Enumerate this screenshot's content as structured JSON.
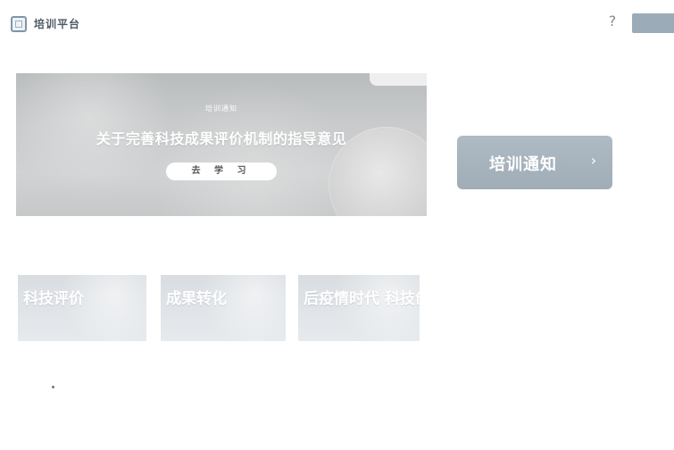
{
  "header": {
    "brand": "培训平台",
    "help_icon_glyph": "?",
    "right_button_label": ""
  },
  "banner": {
    "kicker": "培训通知",
    "title": "关于完善科技成果评价机制的指导意见",
    "button_label": "去 学 习"
  },
  "notice": {
    "label": "培训通知",
    "arrow_icon": "chevron-right-icon",
    "arrow_glyph": "›"
  },
  "thumbnails": [
    {
      "text": "科技评价"
    },
    {
      "text": "成果转化"
    },
    {
      "text": "后疫情时代 科技创新"
    }
  ],
  "colors": {
    "banner_bg": "#c8cacb",
    "notice_bg": "#a9b5bf",
    "header_button_bg": "#9cabb8"
  }
}
